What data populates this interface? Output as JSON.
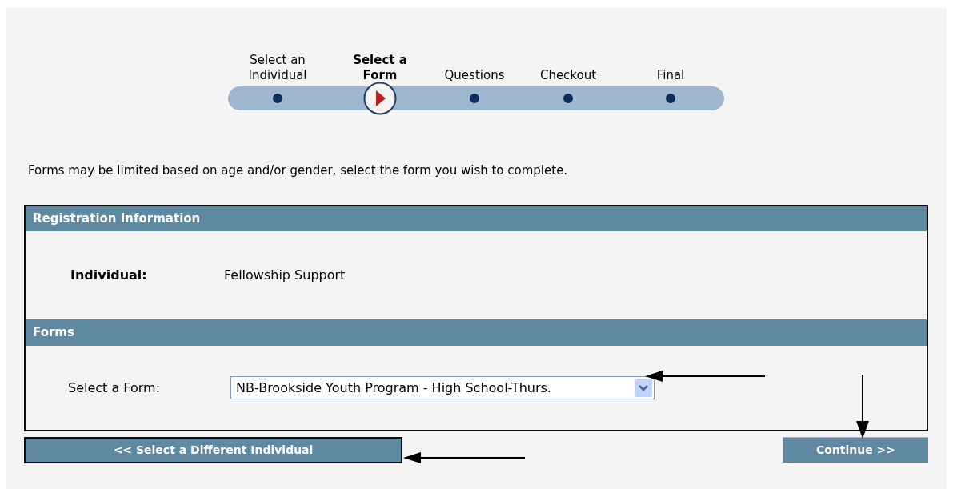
{
  "steps": [
    {
      "label": "Select an Individual",
      "selected": false
    },
    {
      "label": "Select a Form",
      "selected": true
    },
    {
      "label": "Questions",
      "selected": false
    },
    {
      "label": "Checkout",
      "selected": false
    },
    {
      "label": "Final",
      "selected": false
    }
  ],
  "intro": "Forms may be limited based on age and/or gender, select the form you wish to complete.",
  "registration": {
    "title": "Registration Information",
    "label": "Individual:",
    "value": "Fellowship Support"
  },
  "forms": {
    "title": "Forms",
    "label": "Select a Form:",
    "value": "NB-Brookside Youth Program - High School-Thurs."
  },
  "buttons": {
    "back": "<< Select a Different Individual",
    "continue": "Continue >>"
  }
}
